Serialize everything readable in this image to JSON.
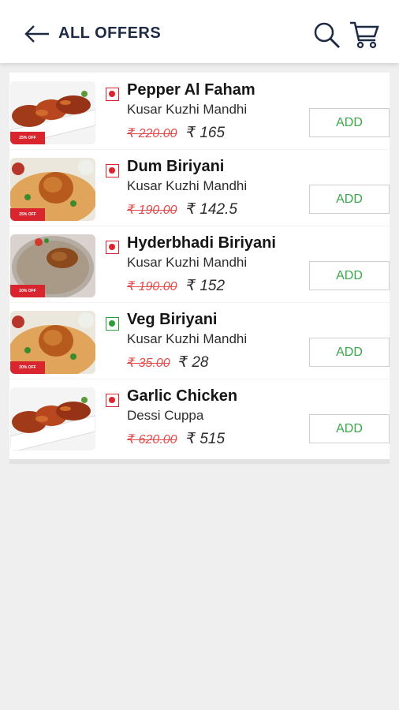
{
  "header": {
    "title": "ALL OFFERS",
    "back_icon": "arrow-left-icon",
    "search_icon": "search-icon",
    "cart_icon": "cart-icon"
  },
  "items": [
    {
      "name": "Pepper Al Faham",
      "restaurant": "Kusar Kuzhi Mandhi",
      "old_price": "₹ 220.00",
      "new_price": "₹ 165",
      "type": "non-veg",
      "offer_tag": "25% OFF",
      "add_label": "ADD"
    },
    {
      "name": "Dum Biriyani",
      "restaurant": "Kusar Kuzhi Mandhi",
      "old_price": "₹ 190.00",
      "new_price": "₹ 142.5",
      "type": "non-veg",
      "offer_tag": "25% OFF",
      "add_label": "ADD"
    },
    {
      "name": "Hyderbhadi Biriyani",
      "restaurant": "Kusar Kuzhi Mandhi",
      "old_price": "₹ 190.00",
      "new_price": "₹ 152",
      "type": "non-veg",
      "offer_tag": "20% OFF",
      "add_label": "ADD"
    },
    {
      "name": "Veg Biriyani",
      "restaurant": "Kusar Kuzhi Mandhi",
      "old_price": "₹ 35.00",
      "new_price": "₹ 28",
      "type": "veg",
      "offer_tag": "20% OFF",
      "add_label": "ADD"
    },
    {
      "name": "Garlic Chicken",
      "restaurant": "Dessi Cuppa",
      "old_price": "₹ 620.00",
      "new_price": "₹ 515",
      "type": "non-veg",
      "offer_tag": "",
      "add_label": "ADD"
    }
  ],
  "colors": {
    "non_veg": "#d9262e",
    "veg": "#2e9b3a",
    "add_text": "#3aa84a",
    "strike_price": "#e24b4b"
  }
}
